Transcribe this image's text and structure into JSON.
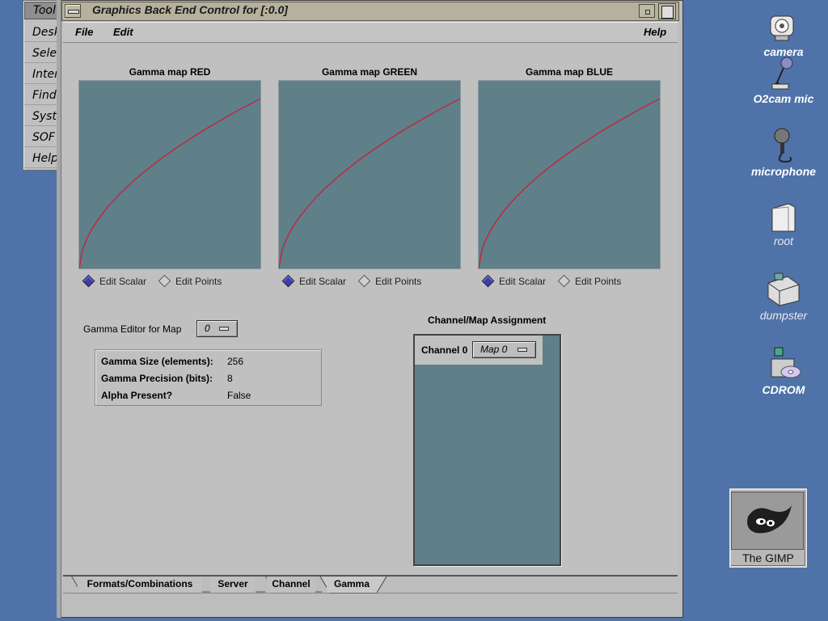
{
  "toolchest": {
    "title": "Tool",
    "items": [
      "Desk",
      "Sele",
      "Inter",
      "Find",
      "Syst",
      "SOF",
      "Help"
    ]
  },
  "window": {
    "title": "Graphics Back End Control for [:0.0]",
    "menu": {
      "file": "File",
      "edit": "Edit",
      "help": "Help"
    }
  },
  "gamma_maps": [
    {
      "title": "Gamma map RED",
      "edit_scalar": "Edit Scalar",
      "edit_points": "Edit Points",
      "selected": "Edit Scalar"
    },
    {
      "title": "Gamma map GREEN",
      "edit_scalar": "Edit Scalar",
      "edit_points": "Edit Points",
      "selected": "Edit Scalar"
    },
    {
      "title": "Gamma map BLUE",
      "edit_scalar": "Edit Scalar",
      "edit_points": "Edit Points",
      "selected": "Edit Scalar"
    }
  ],
  "gamma_editor": {
    "label": "Gamma Editor for Map",
    "value": "0"
  },
  "info": {
    "size_label": "Gamma Size (elements):",
    "size_value": "256",
    "precision_label": "Gamma Precision (bits):",
    "precision_value": "8",
    "alpha_label": "Alpha Present?",
    "alpha_value": "False"
  },
  "assignment": {
    "title": "Channel/Map Assignment",
    "channel_label": "Channel 0",
    "map_value": "Map 0"
  },
  "tabs": [
    {
      "label": "Formats/Combinations",
      "active": false
    },
    {
      "label": "Server",
      "active": false
    },
    {
      "label": "Channel",
      "active": false
    },
    {
      "label": "Gamma",
      "active": true
    }
  ],
  "desktop_icons": {
    "camera": "camera",
    "o2cam": "O2cam mic",
    "microphone": "microphone",
    "root": "root",
    "dumpster": "dumpster",
    "cdrom": "CDROM",
    "gimp": "The GIMP"
  },
  "colors": {
    "desktop": "#4f73a8",
    "plot_bg": "#5f7f89",
    "curve": "#d01830",
    "radio_selected": "#3b3fae"
  }
}
